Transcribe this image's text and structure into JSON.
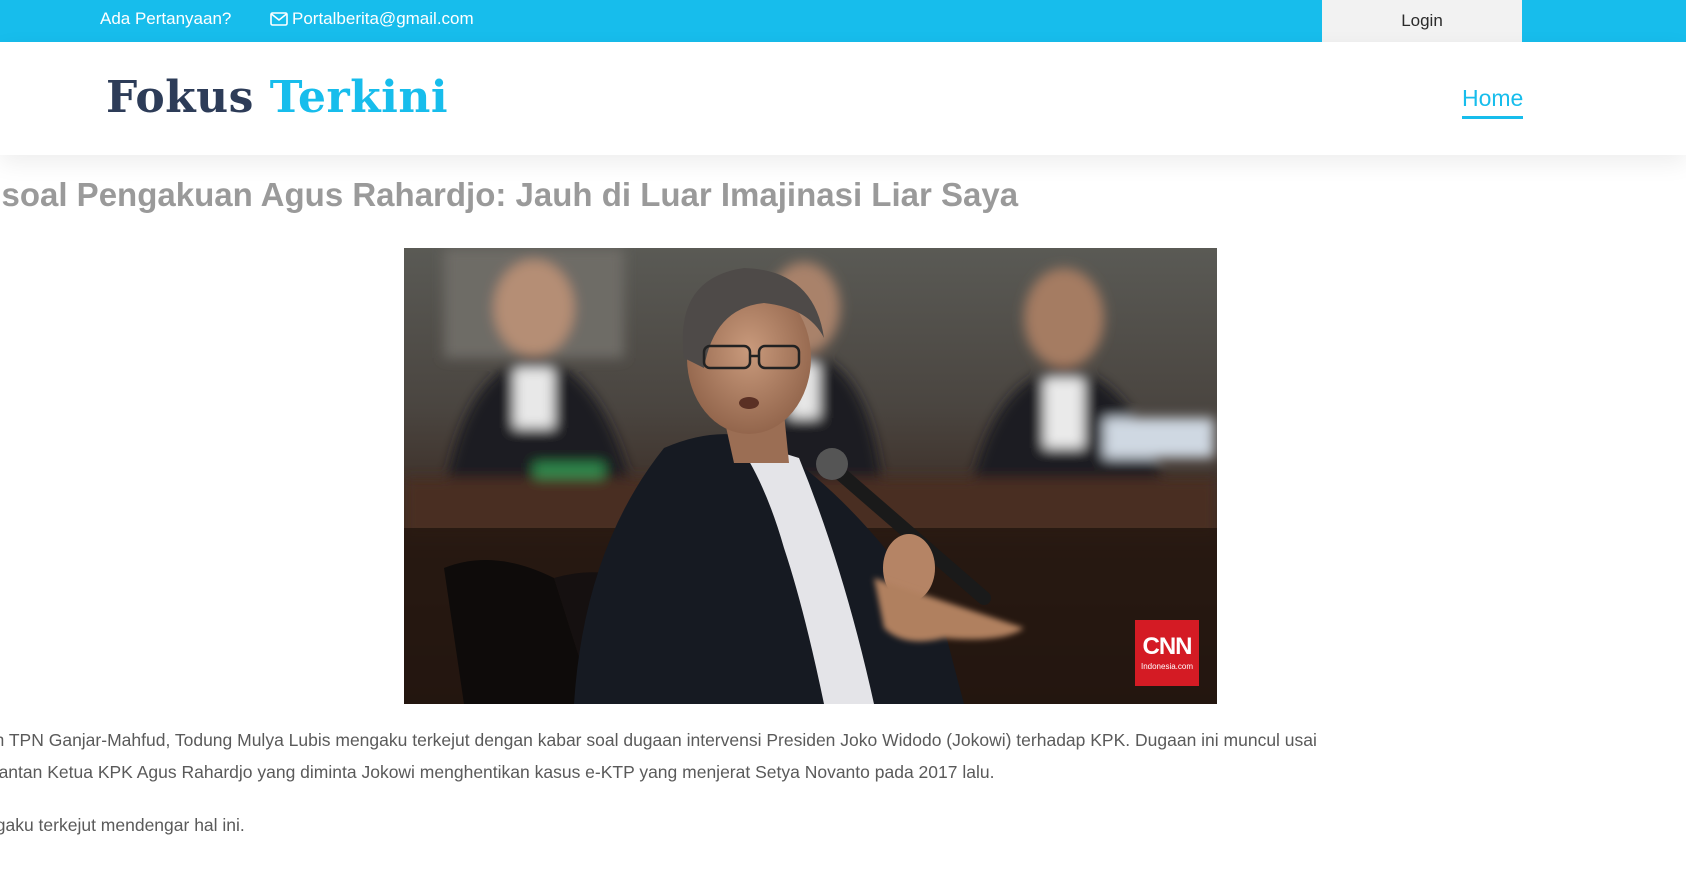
{
  "topbar": {
    "question": "Ada Pertanyaan?",
    "email": "Portalberita@gmail.com",
    "login_label": "Login"
  },
  "brand": {
    "part1": "Fokus",
    "part2": "Terkini"
  },
  "nav": {
    "home_label": "Home"
  },
  "article": {
    "headline": "ng soal Pengakuan Agus Rahardjo: Jauh di Luar Imajinasi Liar Saya",
    "image_watermark": {
      "brand": "CNN",
      "sub": "Indonesia.com"
    },
    "paragraph1_line1": "um TPN Ganjar-Mahfud, Todung Mulya Lubis mengaku terkejut dengan kabar soal dugaan intervensi Presiden Joko Widodo (Jokowi) terhadap KPK. Dugaan ini muncul usai",
    "paragraph1_line2": "mantan Ketua KPK Agus Rahardjo yang diminta Jokowi menghentikan kasus e-KTP yang menjerat Setya Novanto pada 2017 lalu.",
    "paragraph2": "ngaku terkejut mendengar hal ini."
  },
  "colors": {
    "accent": "#17bdec",
    "brand_dark": "#2d3c58",
    "headline_gray": "#9a9a9a",
    "body_text": "#5a5a5a"
  }
}
